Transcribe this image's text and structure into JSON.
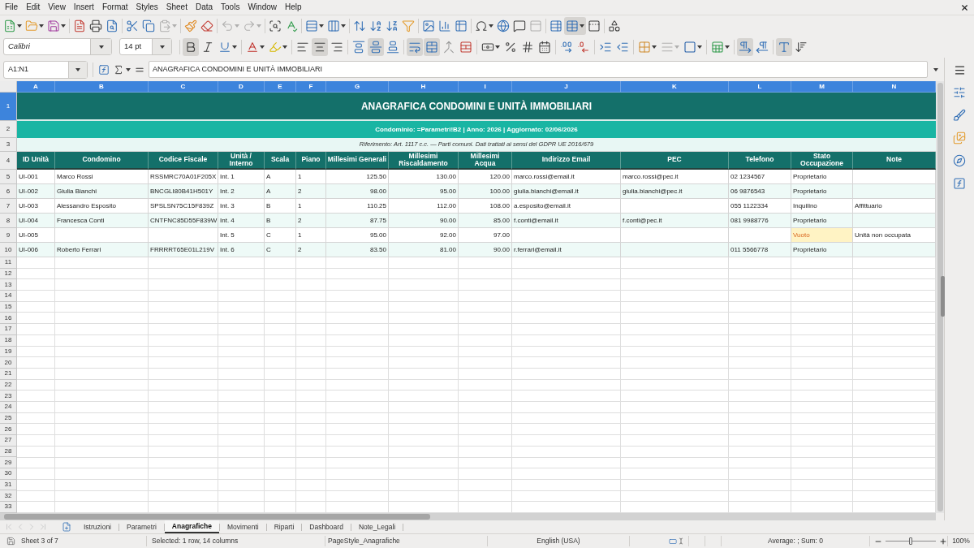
{
  "menu_bar": {
    "items": [
      "File",
      "Edit",
      "View",
      "Insert",
      "Format",
      "Styles",
      "Sheet",
      "Data",
      "Tools",
      "Window",
      "Help"
    ]
  },
  "standard_toolbar": {
    "disabled": {
      "paste": true,
      "undo": true,
      "redo": true,
      "header_footer": true
    },
    "toggles": {
      "freeze_rows_columns": true
    }
  },
  "formatting_toolbar": {
    "font_name": "Calibri",
    "font_size": "14 pt",
    "toggles": {
      "bold": true,
      "italic": false,
      "underline": false,
      "align_left": false,
      "align_center": true,
      "align_right": false,
      "align_top": false,
      "align_middle": true,
      "align_bottom": false,
      "wrap_text": true,
      "merge_and_center": true,
      "paragraph_ltr": true,
      "paragraph_rtl": false,
      "text_horizontal": true,
      "text_vertical": false
    },
    "disabled": {
      "border_style": true
    }
  },
  "formula_bar": {
    "name_box": "A1:N1",
    "formula": "ANAGRAFICA CONDOMINI E UNITÀ IMMOBILIARI"
  },
  "sheet": {
    "column_headers": [
      {
        "label": "A",
        "selected": true
      },
      {
        "label": "B",
        "selected": true
      },
      {
        "label": "C",
        "selected": true
      },
      {
        "label": "D",
        "selected": true
      },
      {
        "label": "E",
        "selected": true
      },
      {
        "label": "F",
        "selected": true
      },
      {
        "label": "G",
        "selected": true
      },
      {
        "label": "H",
        "selected": true
      },
      {
        "label": "I",
        "selected": true
      },
      {
        "label": "J",
        "selected": true
      },
      {
        "label": "K",
        "selected": true
      },
      {
        "label": "L",
        "selected": true
      },
      {
        "label": "M",
        "selected": true
      },
      {
        "label": "N",
        "selected": true
      }
    ],
    "rows": [
      {
        "kind": "title",
        "row_header": "1",
        "selected": true,
        "text": "ANAGRAFICA CONDOMINI E UNITÀ IMMOBILIARI"
      },
      {
        "kind": "subtitle",
        "row_header": "2",
        "selected": false,
        "text": "Condominio: =Parametri!B2 | Anno: 2026 | Aggiornato: 02/06/2026"
      },
      {
        "kind": "note",
        "row_header": "3",
        "selected": false,
        "text": "Riferimento: Art. 1117 c.c. — Parti comuni. Dati trattati ai sensi del GDPR UE 2016/679"
      },
      {
        "kind": "headings",
        "row_header": "4",
        "selected": false,
        "headings": [
          "ID Unità",
          "Condomino",
          "Codice Fiscale",
          "Unità / Interno",
          "Scala",
          "Piano",
          "Millesimi Generali",
          "Millesimi Riscaldamento",
          "Millesimi Acqua",
          "Indirizzo Email",
          "PEC",
          "Telefono",
          "Stato Occupazione",
          "Note"
        ]
      },
      {
        "kind": "data",
        "row_header": "5",
        "selected": false,
        "cells": {
          "id_unita": "UI-001",
          "condomino": "Marco Rossi",
          "codice_fiscale": "RSSMRC70A01F205X",
          "unita_interno": "Int. 1",
          "scala": "A",
          "piano": "1",
          "millesimi_generali": "125.50",
          "millesimi_riscaldamento": "130.00",
          "millesimi_acqua": "120.00",
          "email": "marco.rossi@email.it",
          "pec": "marco.rossi@pec.it",
          "telefono": "02 1234567",
          "stato_occupazione": {
            "text": "Proprietario",
            "highlighted": false
          }
        }
      },
      {
        "kind": "data",
        "row_header": "6",
        "selected": false,
        "cells": {
          "id_unita": "UI-002",
          "condomino": "Giulia Bianchi",
          "codice_fiscale": "BNCGLI80B41H501Y",
          "unita_interno": "Int. 2",
          "scala": "A",
          "piano": "2",
          "millesimi_generali": "98.00",
          "millesimi_riscaldamento": "95.00",
          "millesimi_acqua": "100.00",
          "email": "giulia.bianchi@email.it",
          "pec": "giulia.bianchi@pec.it",
          "telefono": "06 9876543",
          "stato_occupazione": {
            "text": "Proprietario",
            "highlighted": false
          }
        }
      },
      {
        "kind": "data",
        "row_header": "7",
        "selected": false,
        "cells": {
          "id_unita": "UI-003",
          "condomino": "Alessandro Esposito",
          "codice_fiscale": "SPSLSN75C15F839Z",
          "unita_interno": "Int. 3",
          "scala": "B",
          "piano": "1",
          "millesimi_generali": "110.25",
          "millesimi_riscaldamento": "112.00",
          "millesimi_acqua": "108.00",
          "email": "a.esposito@email.it",
          "telefono": "055 1122334",
          "stato_occupazione": {
            "text": "Inquilino",
            "highlighted": false
          },
          "note": "Affittuario"
        }
      },
      {
        "kind": "data",
        "row_header": "8",
        "selected": false,
        "cells": {
          "id_unita": "UI-004",
          "condomino": "Francesca Conti",
          "codice_fiscale": "CNTFNC85D55F839W",
          "unita_interno": "Int. 4",
          "scala": "B",
          "piano": "2",
          "millesimi_generali": "87.75",
          "millesimi_riscaldamento": "90.00",
          "millesimi_acqua": "85.00",
          "email": "f.conti@email.it",
          "pec": "f.conti@pec.it",
          "telefono": "081 9988776",
          "stato_occupazione": {
            "text": "Proprietario",
            "highlighted": false
          }
        }
      },
      {
        "kind": "data",
        "row_header": "9",
        "selected": false,
        "cells": {
          "id_unita": "UI-005",
          "unita_interno": "Int. 5",
          "scala": "C",
          "piano": "1",
          "millesimi_generali": "95.00",
          "millesimi_riscaldamento": "92.00",
          "millesimi_acqua": "97.00",
          "stato_occupazione": {
            "text": "Vuoto",
            "highlighted": true
          },
          "note": "Unità non occupata"
        }
      },
      {
        "kind": "data",
        "row_header": "10",
        "selected": false,
        "cells": {
          "id_unita": "UI-006",
          "condomino": "Roberto Ferrari",
          "codice_fiscale": "FRRRRT65E01L219V",
          "unita_interno": "Int. 6",
          "scala": "C",
          "piano": "2",
          "millesimi_generali": "83.50",
          "millesimi_riscaldamento": "81.00",
          "millesimi_acqua": "90.00",
          "email": "r.ferrari@email.it",
          "telefono": "011 5566778",
          "stato_occupazione": {
            "text": "Proprietario",
            "highlighted": false
          }
        }
      },
      {
        "kind": "empty",
        "row_header": "11",
        "selected": false
      },
      {
        "kind": "empty",
        "row_header": "12",
        "selected": false
      },
      {
        "kind": "empty",
        "row_header": "13",
        "selected": false
      },
      {
        "kind": "empty",
        "row_header": "14",
        "selected": false
      },
      {
        "kind": "empty",
        "row_header": "15",
        "selected": false
      },
      {
        "kind": "empty",
        "row_header": "16",
        "selected": false
      },
      {
        "kind": "empty",
        "row_header": "17",
        "selected": false
      },
      {
        "kind": "empty",
        "row_header": "18",
        "selected": false
      },
      {
        "kind": "empty",
        "row_header": "19",
        "selected": false
      },
      {
        "kind": "empty",
        "row_header": "20",
        "selected": false
      },
      {
        "kind": "empty",
        "row_header": "21",
        "selected": false
      },
      {
        "kind": "empty",
        "row_header": "22",
        "selected": false
      },
      {
        "kind": "empty",
        "row_header": "23",
        "selected": false
      },
      {
        "kind": "empty",
        "row_header": "24",
        "selected": false
      },
      {
        "kind": "empty",
        "row_header": "25",
        "selected": false
      },
      {
        "kind": "empty",
        "row_header": "26",
        "selected": false
      },
      {
        "kind": "empty",
        "row_header": "27",
        "selected": false
      },
      {
        "kind": "empty",
        "row_header": "28",
        "selected": false
      },
      {
        "kind": "empty",
        "row_header": "29",
        "selected": false
      },
      {
        "kind": "empty",
        "row_header": "30",
        "selected": false
      },
      {
        "kind": "empty",
        "row_header": "31",
        "selected": false
      },
      {
        "kind": "empty",
        "row_header": "32",
        "selected": false
      },
      {
        "kind": "empty",
        "row_header": "33",
        "selected": false
      }
    ]
  },
  "sheet_tabs": {
    "navigation_disabled": true,
    "tabs": [
      {
        "label": "Istruzioni",
        "selected": false
      },
      {
        "label": "Parametri",
        "selected": false
      },
      {
        "label": "Anagrafiche",
        "selected": true
      },
      {
        "label": "Movimenti",
        "selected": false
      },
      {
        "label": "Riparti",
        "selected": false
      },
      {
        "label": "Dashboard",
        "selected": false
      },
      {
        "label": "Note_Legali",
        "selected": false
      }
    ]
  },
  "status_bar": {
    "sheet_position": "Sheet 3 of 7",
    "selection": "Selected: 1 row, 14 columns",
    "page_style": "PageStyle_Anagrafiche",
    "language": "English (USA)",
    "summary": "Average: ; Sum: 0",
    "zoom_slider": {
      "level": 0.5
    },
    "zoom": "100%"
  }
}
